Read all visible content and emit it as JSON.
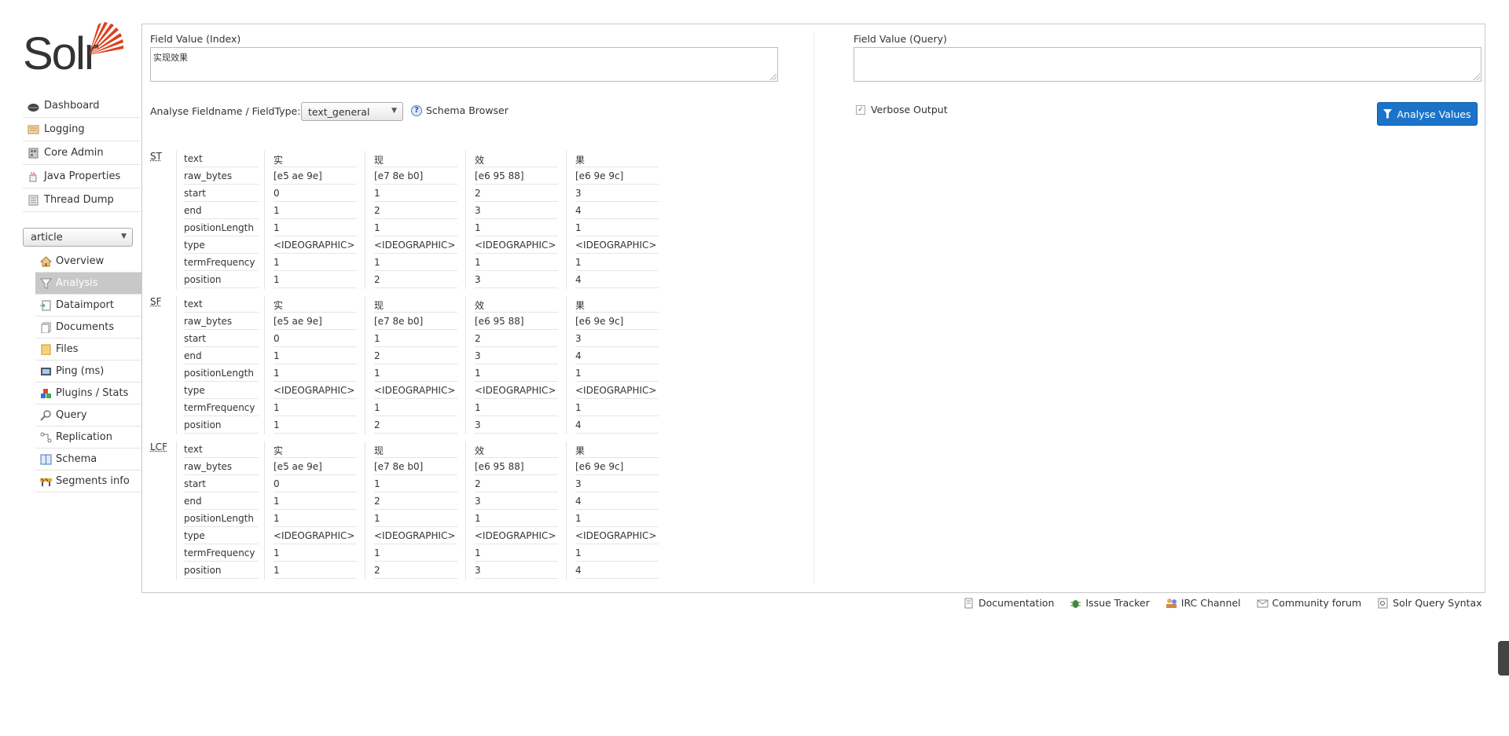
{
  "logo": {
    "text": "Solr"
  },
  "menu": [
    {
      "label": "Dashboard",
      "icon": "dashboard-icon"
    },
    {
      "label": "Logging",
      "icon": "logging-icon"
    },
    {
      "label": "Core Admin",
      "icon": "core-admin-icon"
    },
    {
      "label": "Java Properties",
      "icon": "java-icon"
    },
    {
      "label": "Thread Dump",
      "icon": "thread-dump-icon"
    }
  ],
  "core_selector": {
    "value": "article"
  },
  "core_menu": [
    {
      "label": "Overview",
      "icon": "home-icon",
      "active": false
    },
    {
      "label": "Analysis",
      "icon": "funnel-icon",
      "active": true
    },
    {
      "label": "Dataimport",
      "icon": "dataimport-icon",
      "active": false
    },
    {
      "label": "Documents",
      "icon": "documents-icon",
      "active": false
    },
    {
      "label": "Files",
      "icon": "folder-icon",
      "active": false
    },
    {
      "label": "Ping (ms)",
      "icon": "ping-icon",
      "active": false
    },
    {
      "label": "Plugins / Stats",
      "icon": "plugins-icon",
      "active": false
    },
    {
      "label": "Query",
      "icon": "magnifier-icon",
      "active": false
    },
    {
      "label": "Replication",
      "icon": "replication-icon",
      "active": false
    },
    {
      "label": "Schema",
      "icon": "schema-icon",
      "active": false
    },
    {
      "label": "Segments info",
      "icon": "segments-icon",
      "active": false
    }
  ],
  "analysis": {
    "index_label": "Field Value (Index)",
    "index_value": "实现效果",
    "query_label": "Field Value (Query)",
    "query_value": "",
    "fieldtype_label": "Analyse Fieldname / FieldType:",
    "fieldtype_value": "text_general",
    "schema_browser_label": "Schema Browser",
    "verbose_label": "Verbose Output",
    "verbose_checked": true,
    "button_label": "Analyse Values"
  },
  "row_keys": [
    "text",
    "raw_bytes",
    "start",
    "end",
    "positionLength",
    "type",
    "termFrequency",
    "position"
  ],
  "stages": [
    {
      "abbr": "ST",
      "tokens": [
        [
          "实",
          "[e5 ae 9e]",
          "0",
          "1",
          "1",
          "<IDEOGRAPHIC>",
          "1",
          "1"
        ],
        [
          "现",
          "[e7 8e b0]",
          "1",
          "2",
          "1",
          "<IDEOGRAPHIC>",
          "1",
          "2"
        ],
        [
          "效",
          "[e6 95 88]",
          "2",
          "3",
          "1",
          "<IDEOGRAPHIC>",
          "1",
          "3"
        ],
        [
          "果",
          "[e6 9e 9c]",
          "3",
          "4",
          "1",
          "<IDEOGRAPHIC>",
          "1",
          "4"
        ]
      ]
    },
    {
      "abbr": "SF",
      "tokens": [
        [
          "实",
          "[e5 ae 9e]",
          "0",
          "1",
          "1",
          "<IDEOGRAPHIC>",
          "1",
          "1"
        ],
        [
          "现",
          "[e7 8e b0]",
          "1",
          "2",
          "1",
          "<IDEOGRAPHIC>",
          "1",
          "2"
        ],
        [
          "效",
          "[e6 95 88]",
          "2",
          "3",
          "1",
          "<IDEOGRAPHIC>",
          "1",
          "3"
        ],
        [
          "果",
          "[e6 9e 9c]",
          "3",
          "4",
          "1",
          "<IDEOGRAPHIC>",
          "1",
          "4"
        ]
      ]
    },
    {
      "abbr": "LCF",
      "tokens": [
        [
          "实",
          "[e5 ae 9e]",
          "0",
          "1",
          "1",
          "<IDEOGRAPHIC>",
          "1",
          "1"
        ],
        [
          "现",
          "[e7 8e b0]",
          "1",
          "2",
          "1",
          "<IDEOGRAPHIC>",
          "1",
          "2"
        ],
        [
          "效",
          "[e6 95 88]",
          "2",
          "3",
          "1",
          "<IDEOGRAPHIC>",
          "1",
          "3"
        ],
        [
          "果",
          "[e6 9e 9c]",
          "3",
          "4",
          "1",
          "<IDEOGRAPHIC>",
          "1",
          "4"
        ]
      ]
    }
  ],
  "footer": [
    {
      "label": "Documentation",
      "icon": "documentation-icon"
    },
    {
      "label": "Issue Tracker",
      "icon": "bug-icon"
    },
    {
      "label": "IRC Channel",
      "icon": "irc-icon"
    },
    {
      "label": "Community forum",
      "icon": "mail-icon"
    },
    {
      "label": "Solr Query Syntax",
      "icon": "query-syntax-icon"
    }
  ],
  "colors": {
    "accent": "#1b74c9",
    "logo_red": "#d9411e",
    "active_bg": "#c8c8c8"
  }
}
